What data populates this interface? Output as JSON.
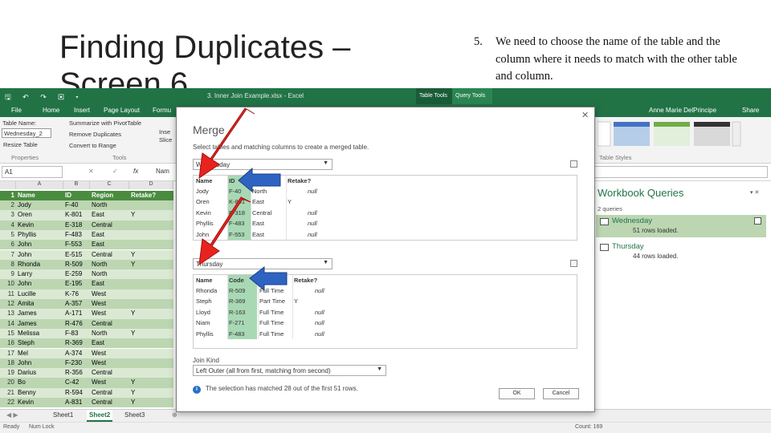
{
  "slide": {
    "title": "Finding Duplicates – Screen 6",
    "note_number": "5.",
    "note_text": "We need to choose the name of the table and the column where it needs to match with the other table and column."
  },
  "excel": {
    "window_title": "3. Inner Join Example.xlsx - Excel",
    "context_tabs": [
      "Table Tools",
      "Query Tools"
    ],
    "menu": [
      "File",
      "Home",
      "Insert",
      "Page Layout",
      "Formu"
    ],
    "user": "Anne Marie DelPrincipe",
    "share": "Share",
    "ribbon": {
      "table_name_label": "Table Name:",
      "table_name_value": "Wednesday_2",
      "resize": "Resize Table",
      "properties": "Properties",
      "summarize": "Summarize with PivotTable",
      "remove_dup": "Remove Duplicates",
      "convert": "Convert to Range",
      "tools": "Tools",
      "insert_slicer": "Inse Slice",
      "table_styles": "Table Styles"
    },
    "name_box": "A1",
    "fx": "fx",
    "formula_value": "Nam",
    "columns": [
      "A",
      "B",
      "C",
      "D"
    ],
    "header": {
      "n": "1",
      "name": "Name",
      "id": "ID",
      "region": "Region",
      "retake": "Retake?"
    },
    "rows": [
      {
        "n": "2",
        "name": "Jody",
        "id": "F-40",
        "region": "North",
        "retake": ""
      },
      {
        "n": "3",
        "name": "Oren",
        "id": "K-801",
        "region": "East",
        "retake": "Y"
      },
      {
        "n": "4",
        "name": "Kevin",
        "id": "E-318",
        "region": "Central",
        "retake": ""
      },
      {
        "n": "5",
        "name": "Phyllis",
        "id": "F-483",
        "region": "East",
        "retake": ""
      },
      {
        "n": "6",
        "name": "John",
        "id": "F-553",
        "region": "East",
        "retake": ""
      },
      {
        "n": "7",
        "name": "John",
        "id": "E-515",
        "region": "Central",
        "retake": "Y"
      },
      {
        "n": "8",
        "name": "Rhonda",
        "id": "R-509",
        "region": "North",
        "retake": "Y"
      },
      {
        "n": "9",
        "name": "Larry",
        "id": "E-259",
        "region": "North",
        "retake": ""
      },
      {
        "n": "10",
        "name": "John",
        "id": "E-195",
        "region": "East",
        "retake": ""
      },
      {
        "n": "11",
        "name": "Lucille",
        "id": "K-76",
        "region": "West",
        "retake": ""
      },
      {
        "n": "12",
        "name": "Amita",
        "id": "A-357",
        "region": "West",
        "retake": ""
      },
      {
        "n": "13",
        "name": "James",
        "id": "A-171",
        "region": "West",
        "retake": "Y"
      },
      {
        "n": "14",
        "name": "James",
        "id": "R-476",
        "region": "Central",
        "retake": ""
      },
      {
        "n": "15",
        "name": "Melissa",
        "id": "F-83",
        "region": "North",
        "retake": "Y"
      },
      {
        "n": "16",
        "name": "Steph",
        "id": "R-369",
        "region": "East",
        "retake": ""
      },
      {
        "n": "17",
        "name": "Mel",
        "id": "A-374",
        "region": "West",
        "retake": ""
      },
      {
        "n": "18",
        "name": "John",
        "id": "F-230",
        "region": "West",
        "retake": ""
      },
      {
        "n": "19",
        "name": "Darius",
        "id": "R-356",
        "region": "Central",
        "retake": ""
      },
      {
        "n": "20",
        "name": "Bo",
        "id": "C-42",
        "region": "West",
        "retake": "Y"
      },
      {
        "n": "21",
        "name": "Benny",
        "id": "R-594",
        "region": "Central",
        "retake": "Y"
      },
      {
        "n": "22",
        "name": "Kevin",
        "id": "A-831",
        "region": "Central",
        "retake": "Y"
      }
    ],
    "sheets": [
      "Sheet1",
      "Sheet2",
      "Sheet3"
    ],
    "status": {
      "ready": "Ready",
      "numlock": "Num Lock",
      "count": "Count: 169"
    },
    "workbook_queries": {
      "title": "Workbook Queries",
      "count": "2 queries",
      "items": [
        {
          "name": "Wednesday",
          "loaded": "51 rows loaded."
        },
        {
          "name": "Thursday",
          "loaded": "44 rows loaded."
        }
      ]
    }
  },
  "merge": {
    "title": "Merge",
    "subtitle": "Select tables and matching columns to create a merged table.",
    "table1": {
      "selected": "Wednesday",
      "headers": [
        "Name",
        "ID",
        "Region",
        "Retake?"
      ],
      "rows": [
        [
          "Jody",
          "F-40",
          "North",
          "null"
        ],
        [
          "Oren",
          "K-801",
          "East",
          "Y"
        ],
        [
          "Kevin",
          "E-318",
          "Central",
          "null"
        ],
        [
          "Phyllis",
          "F-483",
          "East",
          "null"
        ],
        [
          "John",
          "F-553",
          "East",
          "null"
        ]
      ]
    },
    "table2": {
      "selected": "Thursday",
      "headers": [
        "Name",
        "Code",
        "Status",
        "Retake?"
      ],
      "rows": [
        [
          "Rhonda",
          "R-509",
          "Full Time",
          "null"
        ],
        [
          "Steph",
          "R-369",
          "Part Time",
          "Y"
        ],
        [
          "Lloyd",
          "R-163",
          "Full Time",
          "null"
        ],
        [
          "Niam",
          "F-271",
          "Full Time",
          "null"
        ],
        [
          "Phyllis",
          "F-483",
          "Full Time",
          "null"
        ]
      ]
    },
    "join_kind_label": "Join Kind",
    "join_kind_value": "Left Outer (all from first, matching from second)",
    "info": "The selection has matched 28 out of the first 51 rows.",
    "ok": "OK",
    "cancel": "Cancel"
  },
  "colors": {
    "excel_green": "#217346",
    "highlight": "#a8d8b4",
    "red_arrow": "#e8231f",
    "blue_arrow": "#2e63c2"
  }
}
